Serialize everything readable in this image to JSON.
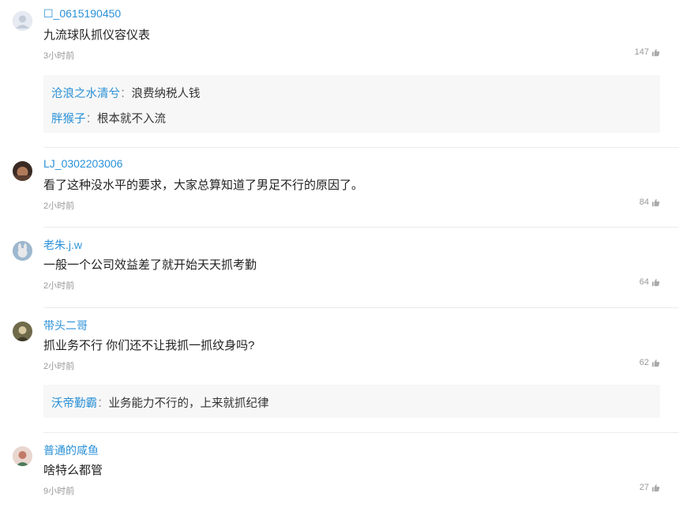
{
  "comments": [
    {
      "username": "☐_0615190450",
      "content": "九流球队抓仪容仪表",
      "time": "3小时前",
      "likes": "147",
      "avatar_color": "#dfe4ee",
      "replies": [
        {
          "name": "沧浪之水清兮",
          "sep": "：",
          "text": "浪费纳税人钱"
        },
        {
          "name": "胖猴子",
          "sep": "：",
          "text": "根本就不入流"
        }
      ]
    },
    {
      "username": "LJ_0302203006",
      "content": "看了这种没水平的要求，大家总算知道了男足不行的原因了。",
      "time": "2小时前",
      "likes": "84",
      "avatar_color": "#7a5a4a",
      "replies": []
    },
    {
      "username": "老朱.j.w",
      "content": "一般一个公司效益差了就开始天天抓考勤",
      "time": "2小时前",
      "likes": "64",
      "avatar_color": "#8fb0c9",
      "replies": []
    },
    {
      "username": "带头二哥",
      "content": "抓业务不行 你们还不让我抓一抓纹身吗?",
      "time": "2小时前",
      "likes": "62",
      "avatar_color": "#8c7b55",
      "replies": [
        {
          "name": "沃帝勤霸",
          "sep": "：",
          "text": "业务能力不行的，上来就抓纪律"
        }
      ]
    },
    {
      "username": "普通的咸鱼",
      "content": "啥特么都管",
      "time": "9小时前",
      "likes": "27",
      "avatar_color": "#c98a7a",
      "replies": []
    }
  ],
  "colors": {
    "username": "#2a90d7",
    "meta": "#999999",
    "reply_bg": "#f7f7f7"
  },
  "icons": {
    "like": "thumbs-up-icon"
  }
}
